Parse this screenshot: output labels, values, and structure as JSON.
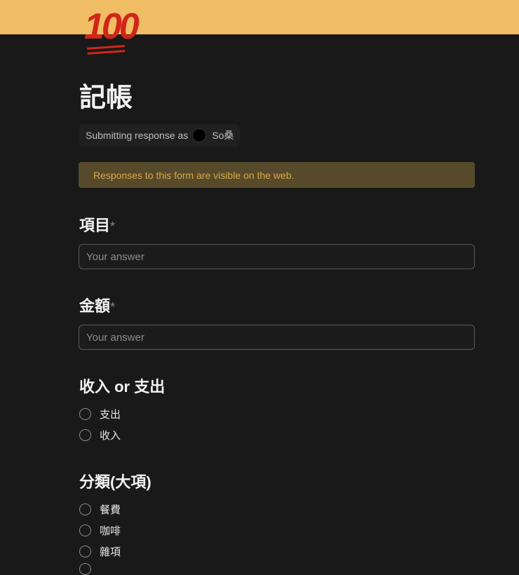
{
  "header": {
    "icon": "💯 hundred-points-emoji",
    "title": "記帳"
  },
  "submitter": {
    "prefix": "Submitting response as",
    "name": "So桑"
  },
  "notice": "Responses to this form are visible on the web.",
  "questions": [
    {
      "label": "項目",
      "required": "*",
      "placeholder": "Your answer"
    },
    {
      "label": "金額",
      "required": "*",
      "placeholder": "Your answer"
    },
    {
      "label": "收入 or 支出",
      "options": [
        "支出",
        "收入"
      ]
    },
    {
      "label": "分類(大項)",
      "options": [
        "餐費",
        "咖啡",
        "雜項"
      ]
    }
  ]
}
